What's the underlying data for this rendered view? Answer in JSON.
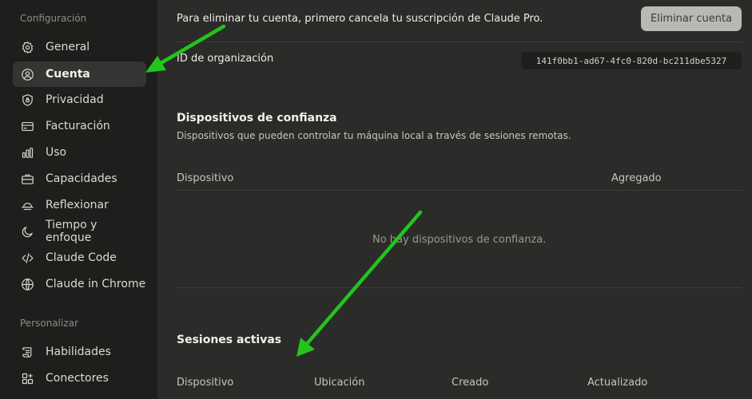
{
  "sidebar": {
    "config_title": "Configuración",
    "personalize_title": "Personalizar",
    "items": [
      {
        "label": "General",
        "icon": "gear-icon"
      },
      {
        "label": "Cuenta",
        "icon": "user-circle-icon",
        "active": true
      },
      {
        "label": "Privacidad",
        "icon": "shield-icon"
      },
      {
        "label": "Facturación",
        "icon": "credit-card-icon"
      },
      {
        "label": "Uso",
        "icon": "bar-chart-icon"
      },
      {
        "label": "Capacidades",
        "icon": "briefcase-icon"
      },
      {
        "label": "Reflexionar",
        "icon": "sunrise-icon"
      },
      {
        "label": "Tiempo y enfoque",
        "icon": "moon-icon"
      },
      {
        "label": "Claude Code",
        "icon": "code-icon"
      },
      {
        "label": "Claude in Chrome",
        "icon": "globe-icon"
      }
    ],
    "personalize_items": [
      {
        "label": "Habilidades",
        "icon": "scroll-icon"
      },
      {
        "label": "Conectores",
        "icon": "puzzle-icon"
      }
    ]
  },
  "account": {
    "delete_message": "Para eliminar tu cuenta, primero cancela tu suscripción de Claude Pro.",
    "delete_button": "Eliminar cuenta",
    "org_label": "ID de organización",
    "org_id": "141f0bb1-ad67-4fc0-820d-bc211dbe5327"
  },
  "trusted_devices": {
    "title": "Dispositivos de confianza",
    "subtitle": "Dispositivos que pueden controlar tu máquina local a través de sesiones remotas.",
    "columns": [
      "Dispositivo",
      "Agregado"
    ],
    "empty": "No hay dispositivos de confianza."
  },
  "sessions": {
    "title": "Sesiones activas",
    "columns": [
      "Dispositivo",
      "Ubicación",
      "Creado",
      "Actualizado"
    ]
  },
  "colors": {
    "arrow": "#22c41e",
    "background": "#2b2b29",
    "sidebar": "#1e1e1d"
  }
}
